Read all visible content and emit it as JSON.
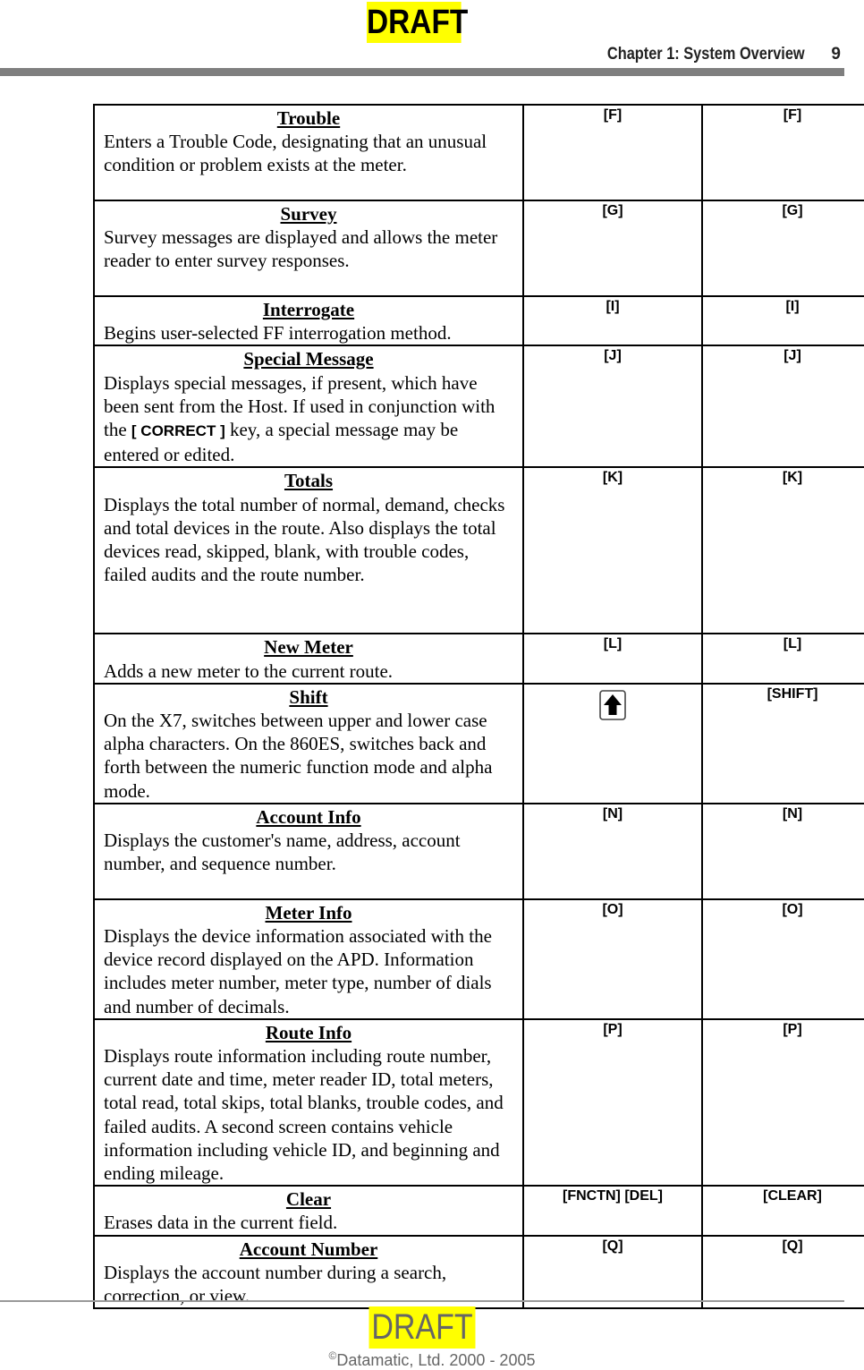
{
  "watermark": {
    "top": "DRAFT",
    "bottom": "DRAFT",
    "highlight_color": "#ffff00"
  },
  "header": {
    "chapter_title": "Chapter 1:  System Overview",
    "page_number": "9"
  },
  "table": {
    "rows": [
      {
        "title": "Trouble",
        "text": "Enters a Trouble Code, designating that an unusual condition or problem exists at the meter.",
        "key1": "[F]",
        "key2": "[F]"
      },
      {
        "title": "Survey",
        "text": "Survey messages are displayed and allows the meter reader to enter survey responses.",
        "key1": "[G]",
        "key2": "[G]"
      },
      {
        "title": "Interrogate",
        "text": "Begins user-selected FF interrogation method.",
        "key1": "[I]",
        "key2": "[I]"
      },
      {
        "title": "Special Message",
        "text_before": "Displays special messages, if present, which have been sent from the Host.  If used in conjunction with the ",
        "inline_key": "[ CORRECT ]",
        "text_after": " key, a special message may be entered or edited.",
        "key1": "[J]",
        "key2": "[J]"
      },
      {
        "title": "Totals",
        "text": "Displays the total number of normal, demand, checks and total devices in the route.  Also displays the total devices read, skipped, blank, with trouble codes, failed audits and the route number.",
        "key1": "[K]",
        "key2": "[K]"
      },
      {
        "title": "New Meter",
        "text": "Adds a new meter to the current route.",
        "key1": "[L]",
        "key2": "[L]"
      },
      {
        "title": "Shift",
        "text": "On the X7, switches between upper and lower case alpha characters.  On the 860ES, switches back and forth between the numeric function mode and alpha mode.",
        "key1_icon": "shift-up-arrow-icon",
        "key2": "[SHIFT]"
      },
      {
        "title": "Account Info",
        "text": "Displays the customer's name, address, account number, and sequence number.",
        "key1": "[N]",
        "key2": "[N]"
      },
      {
        "title": "Meter Info",
        "text": "Displays the device information associated with the device record displayed on the APD.  Information includes meter number, meter type, number of dials and number of decimals.",
        "key1": "[O]",
        "key2": "[O]"
      },
      {
        "title": "Route Info",
        "text": "Displays route information including route number, current date and time, meter reader ID, total meters, total read, total skips, total blanks, trouble codes, and failed audits.  A second screen contains vehicle information including vehicle ID, and beginning and ending mileage.",
        "key1": "[P]",
        "key2": "[P]"
      },
      {
        "title": "Clear",
        "text": "Erases data in the current field.",
        "key1": "[FNCTN] [DEL]",
        "key2": "[CLEAR]"
      },
      {
        "title": "Account Number",
        "text": "Displays the account number during a search, correction, or view.",
        "key1": "[Q]",
        "key2": "[Q]"
      }
    ]
  },
  "footer": {
    "copyright_symbol": "©",
    "copyright_text": "Datamatic, Ltd. 2000 - 2005"
  }
}
